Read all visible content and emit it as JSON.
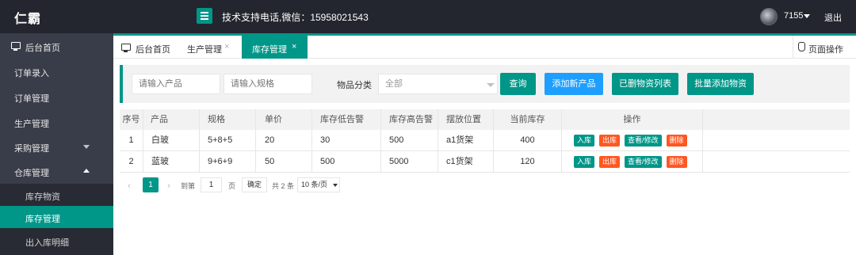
{
  "header": {
    "brand": "仁霸",
    "support_text": "技术支持电话,微信：15958021543",
    "username": "7155",
    "logout": "退出"
  },
  "sidebar": {
    "items": [
      {
        "label": "后台首页"
      },
      {
        "label": "订单录入"
      },
      {
        "label": "订单管理"
      },
      {
        "label": "生产管理"
      },
      {
        "label": "采购管理"
      },
      {
        "label": "仓库管理"
      }
    ],
    "subitems": [
      {
        "label": "库存物资"
      },
      {
        "label": "库存管理"
      },
      {
        "label": "出入库明细"
      }
    ]
  },
  "tabs": [
    {
      "label": "后台首页"
    },
    {
      "label": "生产管理",
      "close": "×"
    },
    {
      "label": "库存管理",
      "close": "×"
    }
  ],
  "page_ops": "页面操作",
  "filter": {
    "product_placeholder": "请输入产品",
    "spec_placeholder": "请输入规格",
    "category_label": "物品分类",
    "category_value": "全部",
    "query": "查询",
    "add_product": "添加新产品",
    "deleted_list": "已删物资列表",
    "batch_add": "批量添加物资"
  },
  "table": {
    "headers": [
      "序号",
      "产品",
      "规格",
      "单价",
      "库存低告警",
      "库存高告警",
      "摆放位置",
      "当前库存",
      "操作"
    ],
    "rows": [
      [
        "1",
        "白玻",
        "5+8+5",
        "20",
        "30",
        "500",
        "a1货架",
        "400"
      ],
      [
        "2",
        "蓝玻",
        "9+6+9",
        "50",
        "500",
        "5000",
        "c1货架",
        "120"
      ]
    ],
    "ops": {
      "in": "入库",
      "out": "出库",
      "view": "查看/修改",
      "delete": "删除"
    },
    "colors": {
      "accent": "#009688",
      "blue": "#1e9fff",
      "danger": "#ff5722"
    }
  },
  "pager": {
    "prev": "‹",
    "current": "1",
    "next": "›",
    "goto": "到第",
    "page_input": "1",
    "page_unit": "页",
    "confirm": "确定",
    "total": "共 2 条",
    "page_size": "10 条/页"
  }
}
